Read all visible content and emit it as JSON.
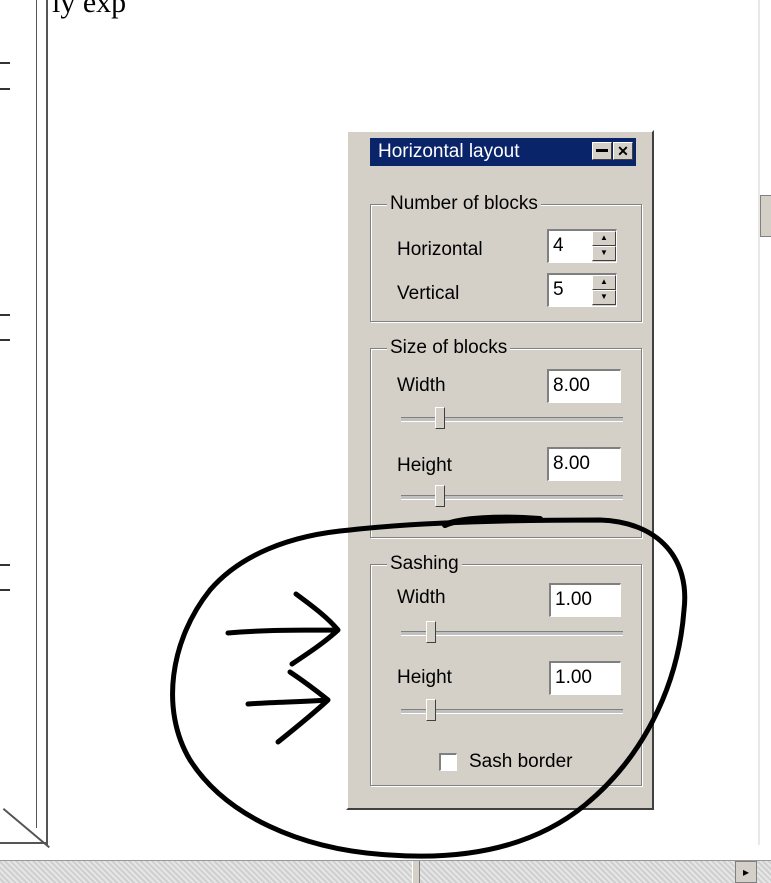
{
  "page_top_text": "ly exp",
  "panel": {
    "title": "Horizontal layout",
    "minimize_icon": "minimize-icon",
    "close_icon": "close-icon",
    "close_glyph": "✕",
    "number_of_blocks": {
      "legend": "Number of blocks",
      "horizontal_label": "Horizontal",
      "horizontal_value": "4",
      "vertical_label": "Vertical",
      "vertical_value": "5"
    },
    "size_of_blocks": {
      "legend": "Size of blocks",
      "width_label": "Width",
      "width_value": "8.00",
      "width_slider_level": 0.16,
      "height_label": "Height",
      "height_value": "8.00",
      "height_slider_level": 0.16
    },
    "sashing": {
      "legend": "Sashing",
      "width_label": "Width",
      "width_value": "1.00",
      "width_slider_level": 0.12,
      "height_label": "Height",
      "height_value": "1.00",
      "height_slider_level": 0.12,
      "sash_border_label": "Sash border",
      "sash_border_checked": false
    }
  },
  "scrollbar": {
    "right_arrow_glyph": "▸"
  },
  "annotation": {
    "description_icon": "hand-drawn-circle-with-arrows",
    "stroke_color": "#000000"
  }
}
